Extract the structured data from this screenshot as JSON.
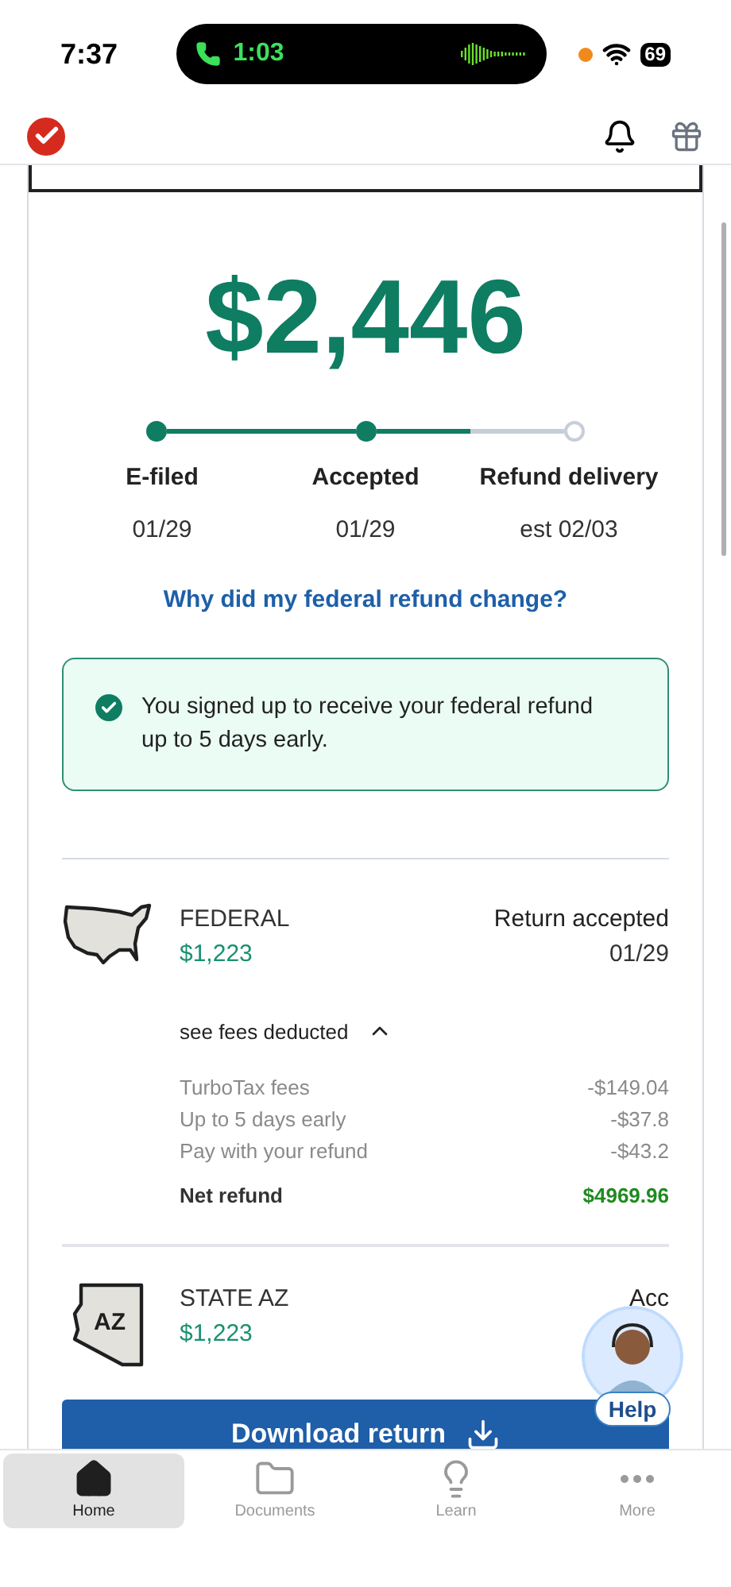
{
  "status_bar": {
    "time": "7:37",
    "call_time": "1:03",
    "battery": "69"
  },
  "refund": {
    "amount": "$2,446",
    "steps": [
      {
        "label": "E-filed",
        "date": "01/29",
        "done": true
      },
      {
        "label": "Accepted",
        "date": "01/29",
        "done": true
      },
      {
        "label": "Refund delivery",
        "date": "est 02/03",
        "done": false
      }
    ],
    "link": "Why did my federal refund change?",
    "notice": "You signed up to receive your federal refund up to 5 days early."
  },
  "returns": [
    {
      "kind": "federal",
      "name": "FEDERAL",
      "amount": "$1,223",
      "status": "Return accepted",
      "date": "01/29",
      "fees": {
        "toggle": "see fees deducted",
        "expanded": true,
        "items": [
          {
            "label": "TurboTax fees",
            "value": "-$149.04"
          },
          {
            "label": "Up to 5 days early",
            "value": "-$37.8"
          },
          {
            "label": "Pay with your refund",
            "value": "-$43.2"
          }
        ],
        "net_label": "Net refund",
        "net_value": "$4969.96"
      }
    },
    {
      "kind": "state",
      "name": "STATE AZ",
      "badge": "AZ",
      "amount": "$1,223",
      "status": "Acc"
    }
  ],
  "download_button": "Download return",
  "help": "Help",
  "tabs": [
    {
      "label": "Home",
      "kind": "home",
      "selected": true
    },
    {
      "label": "Documents",
      "kind": "folder",
      "selected": false
    },
    {
      "label": "Learn",
      "kind": "bulb",
      "selected": false
    },
    {
      "label": "More",
      "kind": "more",
      "selected": false
    }
  ]
}
